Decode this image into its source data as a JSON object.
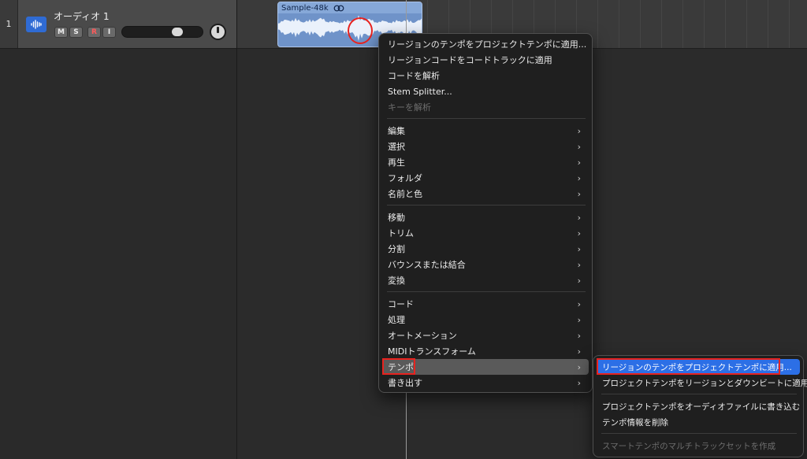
{
  "track": {
    "number": "1",
    "name": "オーディオ 1",
    "buttons": {
      "mute": "M",
      "solo": "S",
      "record": "R",
      "input": "I"
    },
    "volume_level": 0.72,
    "icon": "waveform-icon"
  },
  "region": {
    "name": "Sample-48k",
    "icon": "loop-icon"
  },
  "context_menu": {
    "groups": [
      [
        {
          "label": "リージョンのテンポをプロジェクトテンポに適用...",
          "submenu": false,
          "disabled": false
        },
        {
          "label": "リージョンコードをコードトラックに適用",
          "submenu": false,
          "disabled": false
        },
        {
          "label": "コードを解析",
          "submenu": false,
          "disabled": false
        },
        {
          "label": "Stem Splitter...",
          "submenu": false,
          "disabled": false
        },
        {
          "label": "キーを解析",
          "submenu": false,
          "disabled": true
        }
      ],
      [
        {
          "label": "編集",
          "submenu": true,
          "disabled": false
        },
        {
          "label": "選択",
          "submenu": true,
          "disabled": false
        },
        {
          "label": "再生",
          "submenu": true,
          "disabled": false
        },
        {
          "label": "フォルダ",
          "submenu": true,
          "disabled": false
        },
        {
          "label": "名前と色",
          "submenu": true,
          "disabled": false
        }
      ],
      [
        {
          "label": "移動",
          "submenu": true,
          "disabled": false
        },
        {
          "label": "トリム",
          "submenu": true,
          "disabled": false
        },
        {
          "label": "分割",
          "submenu": true,
          "disabled": false
        },
        {
          "label": "バウンスまたは結合",
          "submenu": true,
          "disabled": false
        },
        {
          "label": "変換",
          "submenu": true,
          "disabled": false
        }
      ],
      [
        {
          "label": "コード",
          "submenu": true,
          "disabled": false
        },
        {
          "label": "処理",
          "submenu": true,
          "disabled": false
        },
        {
          "label": "オートメーション",
          "submenu": true,
          "disabled": false
        },
        {
          "label": "MIDIトランスフォーム",
          "submenu": true,
          "disabled": false
        },
        {
          "label": "テンポ",
          "submenu": true,
          "disabled": false,
          "hover": true
        },
        {
          "label": "書き出す",
          "submenu": true,
          "disabled": false
        }
      ]
    ],
    "chevron": "›"
  },
  "tempo_submenu": {
    "groups": [
      [
        {
          "label": "リージョンのテンポをプロジェクトテンポに適用...",
          "selected": true,
          "disabled": false
        },
        {
          "label": "プロジェクトテンポをリージョンとダウンビートに適用",
          "selected": false,
          "disabled": false
        }
      ],
      [
        {
          "label": "プロジェクトテンポをオーディオファイルに書き込む",
          "selected": false,
          "disabled": false
        },
        {
          "label": "テンポ情報を削除",
          "selected": false,
          "disabled": false
        }
      ],
      [
        {
          "label": "スマートテンポのマルチトラックセットを作成",
          "selected": false,
          "disabled": true
        }
      ]
    ]
  },
  "colors": {
    "accent": "#2c6fe6",
    "annotation": "#e8231f",
    "region": "#6f93c9",
    "track_icon": "#2f6bd4"
  }
}
